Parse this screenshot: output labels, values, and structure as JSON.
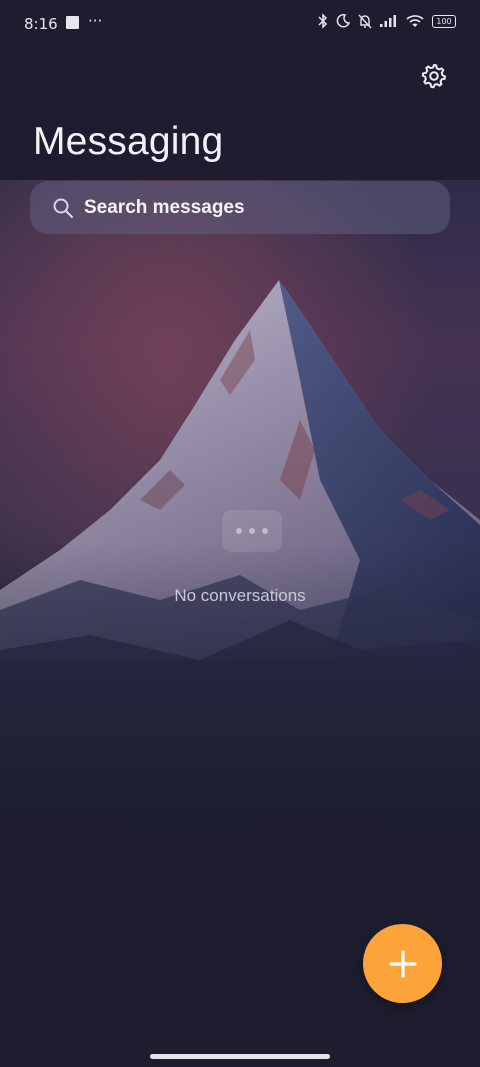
{
  "status_bar": {
    "time": "8:16",
    "more_notifications": "···",
    "battery": "100"
  },
  "header": {
    "title": "Messaging",
    "settings_icon": "gear-icon"
  },
  "search": {
    "placeholder": "Search messages",
    "icon": "search-icon"
  },
  "empty_state": {
    "text": "No conversations",
    "icon": "chat-dots-icon"
  },
  "fab": {
    "icon": "plus-icon",
    "color": "#fca43a"
  },
  "colors": {
    "background": "#1d1d2f",
    "accent": "#fca43a"
  }
}
